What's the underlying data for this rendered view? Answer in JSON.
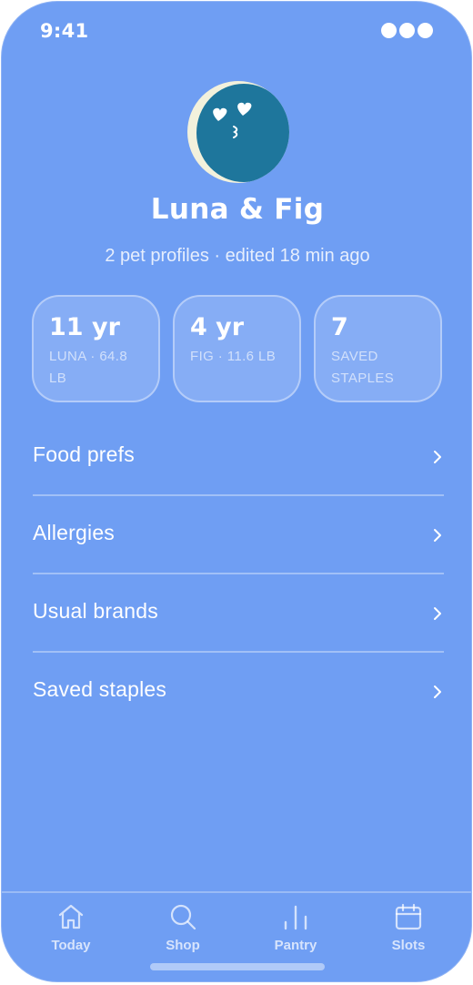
{
  "status_bar": {
    "time": "9:41",
    "indicator_icon": "status-dots-icon"
  },
  "profile": {
    "avatar_icon": "pet-hearts-avatar-icon",
    "name": "Luna & Fig",
    "subtitle": "2 pet profiles · edited 18 min ago"
  },
  "stats": [
    {
      "value": "11 yr",
      "label": "LUNA · 64.8 LB"
    },
    {
      "value": "4 yr",
      "label": "FIG · 11.6 LB"
    },
    {
      "value": "7",
      "label": "SAVED STAPLES"
    }
  ],
  "menu": [
    {
      "label": "Food prefs",
      "icon": "chevron-right-icon"
    },
    {
      "label": "Allergies",
      "icon": "chevron-right-icon"
    },
    {
      "label": "Usual brands",
      "icon": "chevron-right-icon"
    },
    {
      "label": "Saved staples",
      "icon": "chevron-right-icon"
    }
  ],
  "tabs": [
    {
      "label": "Today",
      "icon": "home-icon"
    },
    {
      "label": "Shop",
      "icon": "search-icon"
    },
    {
      "label": "Pantry",
      "icon": "bar-chart-icon"
    },
    {
      "label": "Slots",
      "icon": "calendar-icon"
    }
  ],
  "colors": {
    "background": "#6f9ef3",
    "avatar_fill": "#1e769c",
    "avatar_ring": "#f2f1dc"
  }
}
